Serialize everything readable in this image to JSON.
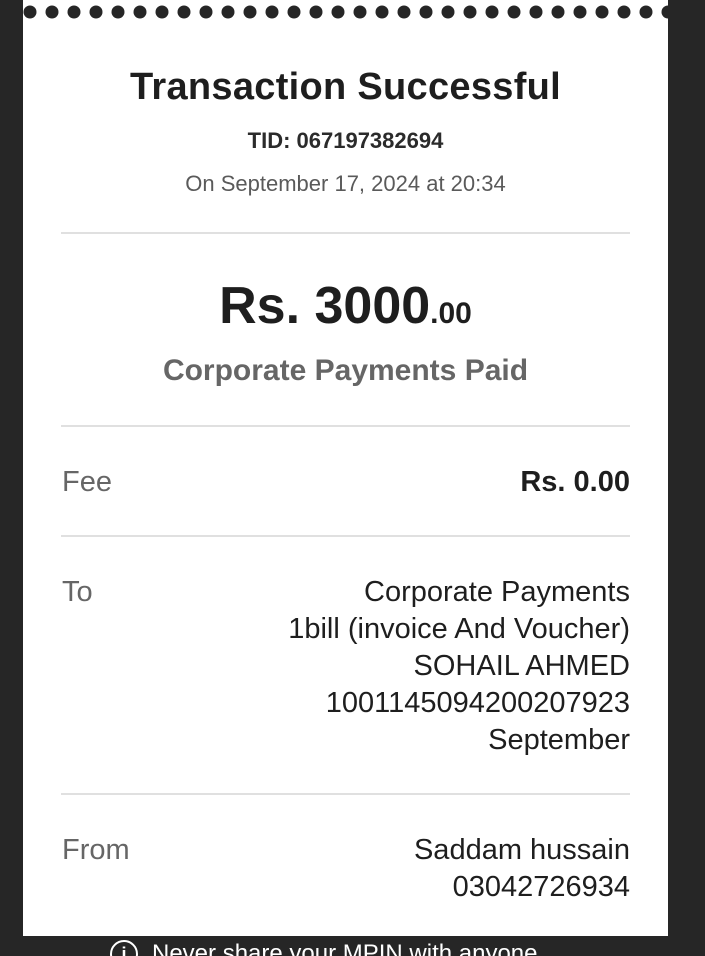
{
  "receipt": {
    "title": "Transaction Successful",
    "tid": "TID: 067197382694",
    "datetime": "On September 17, 2024 at 20:34",
    "amount_main": "Rs. 3000",
    "amount_cents": ".00",
    "status": "Corporate Payments Paid"
  },
  "fee": {
    "label": "Fee",
    "value": "Rs. 0.00"
  },
  "to": {
    "label": "To",
    "lines": [
      "Corporate Payments",
      "1bill (invoice And Voucher)",
      "SOHAIL AHMED",
      "1001145094200207923",
      "September"
    ]
  },
  "from": {
    "label": "From",
    "lines": [
      "Saddam hussain",
      "03042726934"
    ]
  },
  "footer": {
    "icon": "info-icon",
    "text": "Never share your MPIN with anyone"
  }
}
